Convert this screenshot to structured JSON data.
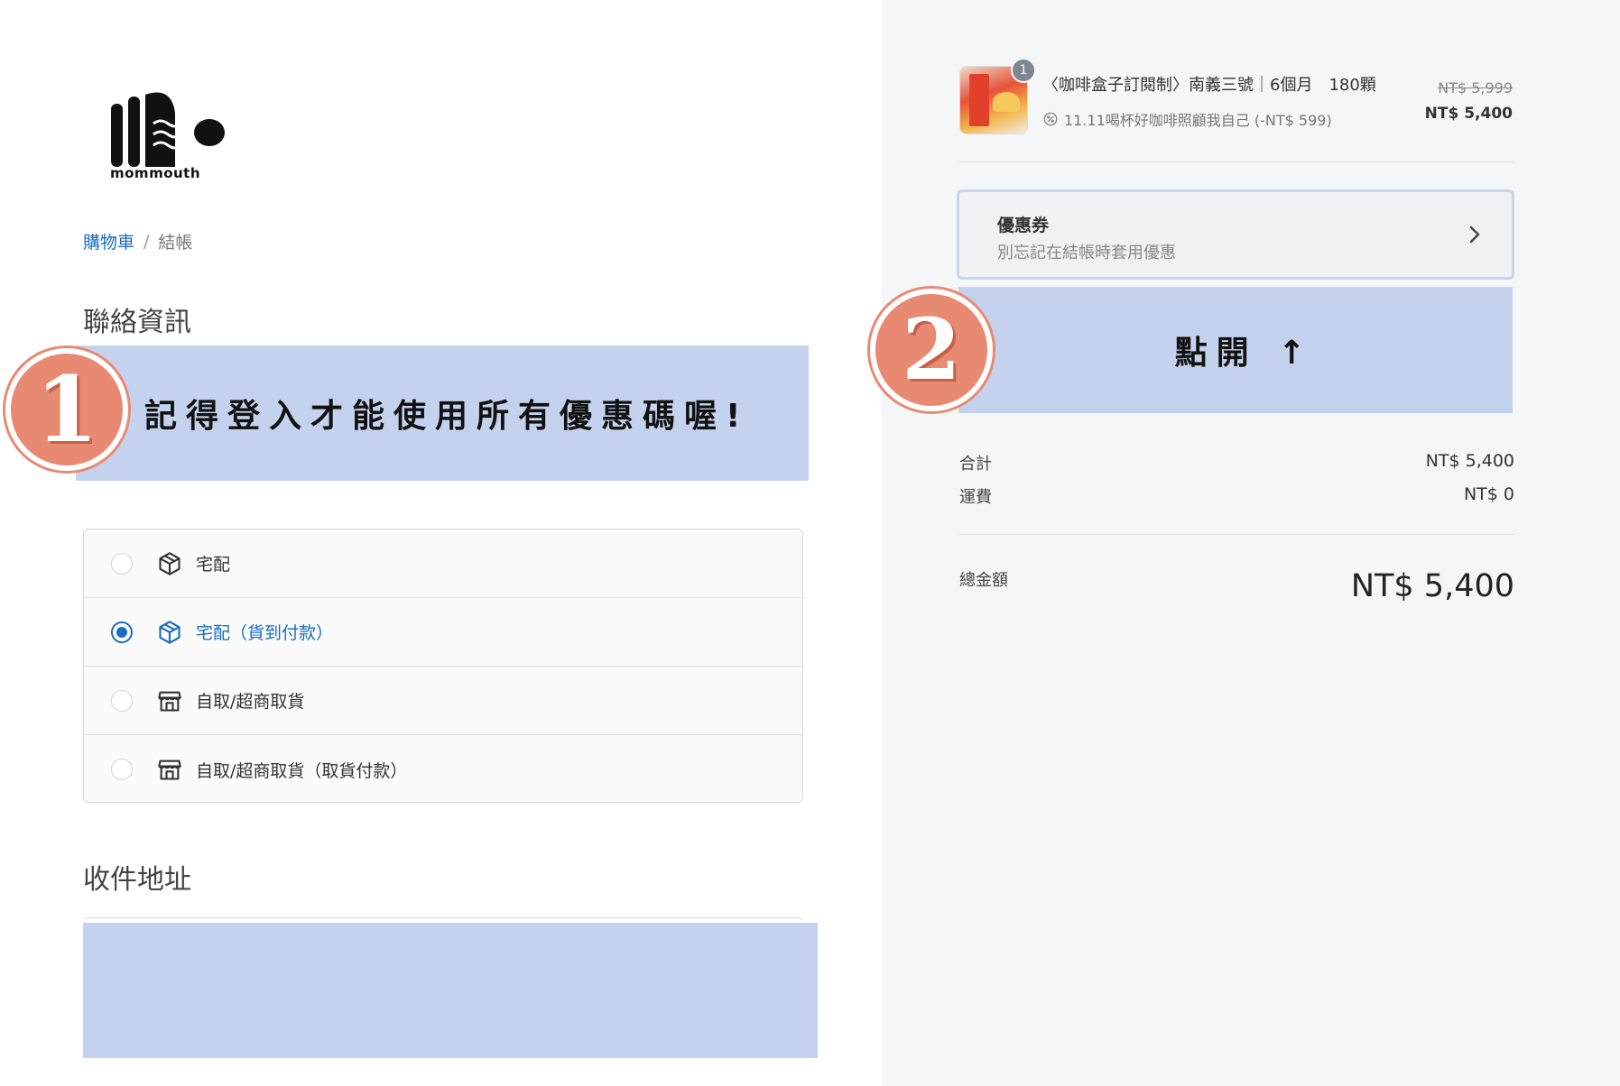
{
  "brand": {
    "logo_text": "mommouth"
  },
  "breadcrumb": {
    "cart": "購物車",
    "separator": "/",
    "current": "結帳"
  },
  "contact": {
    "title": "聯絡資訊"
  },
  "banner1": {
    "badge": "1",
    "text": "記得登入才能使用所有優惠碼喔!"
  },
  "shipping": {
    "options": [
      {
        "label": "宅配",
        "icon": "box-icon",
        "selected": false
      },
      {
        "label": "宅配（貨到付款）",
        "icon": "box-icon",
        "selected": true
      },
      {
        "label": "自取/超商取貨",
        "icon": "store-icon",
        "selected": false
      },
      {
        "label": "自取/超商取貨（取貨付款）",
        "icon": "store-icon",
        "selected": false
      }
    ]
  },
  "address": {
    "title": "收件地址"
  },
  "order": {
    "item": {
      "quantity": "1",
      "name": "〈咖啡盒子訂閱制〉南義三號｜6個月　180顆",
      "discount": "11.11喝杯好咖啡照顧我自己 (-NT$ 599)",
      "price_original": "NT$ 5,999",
      "price_final": "NT$ 5,400"
    },
    "coupon": {
      "title": "優惠券",
      "subtitle": "別忘記在結帳時套用優惠"
    },
    "banner2": {
      "badge": "2",
      "text": "點開 ↑"
    },
    "subtotal_label": "合計",
    "subtotal_value": "NT$ 5,400",
    "shipping_label": "運費",
    "shipping_value": "NT$ 0",
    "total_label": "總金額",
    "total_value": "NT$ 5,400"
  },
  "colors": {
    "accent": "#1a6cc0",
    "banner": "#c5d2ee",
    "badge": "#e88a72"
  }
}
